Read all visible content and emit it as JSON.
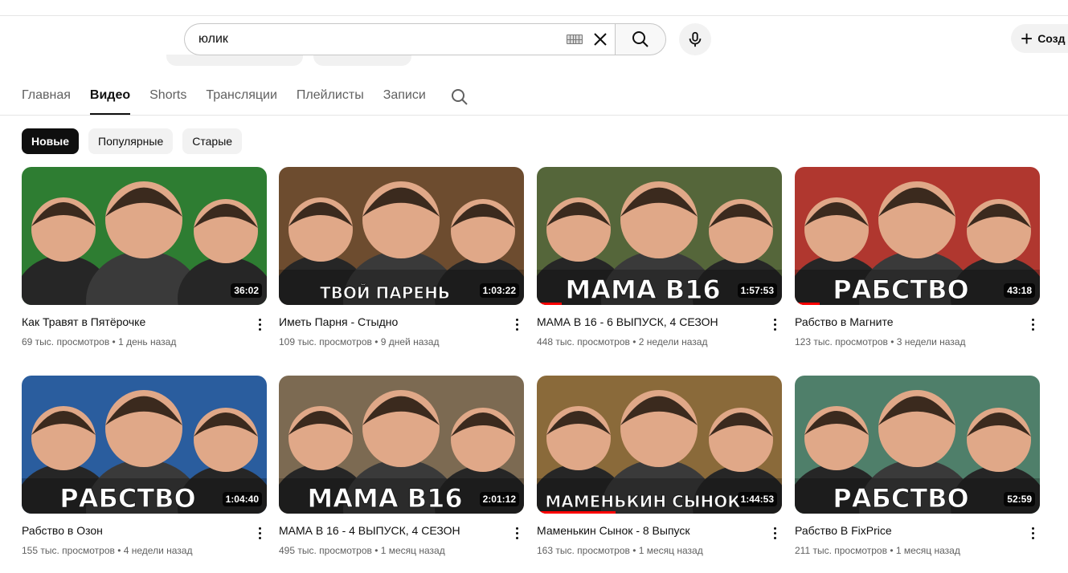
{
  "search": {
    "value": "юлик"
  },
  "header": {
    "create_label": "Созд"
  },
  "tabs": [
    {
      "label": "Главная",
      "active": false
    },
    {
      "label": "Видео",
      "active": true
    },
    {
      "label": "Shorts",
      "active": false
    },
    {
      "label": "Трансляции",
      "active": false
    },
    {
      "label": "Плейлисты",
      "active": false
    },
    {
      "label": "Записи",
      "active": false
    }
  ],
  "chips": [
    {
      "label": "Новые",
      "active": true
    },
    {
      "label": "Популярные",
      "active": false
    },
    {
      "label": "Старые",
      "active": false
    }
  ],
  "videos": [
    {
      "title": "Как Травят в Пятёрочке",
      "views": "69 тыс. просмотров",
      "age": "1 день назад",
      "duration": "36:02",
      "thumb_text": "",
      "bg": "#2e7d32",
      "progress": 0
    },
    {
      "title": "Иметь Парня - Стыдно",
      "views": "109 тыс. просмотров",
      "age": "9 дней назад",
      "duration": "1:03:22",
      "thumb_text": "ТВОЙ ПАРЕНЬ",
      "bg": "#6d4c2f",
      "progress": 0
    },
    {
      "title": "МАМА В 16 - 6 ВЫПУСК, 4 СЕЗОН",
      "views": "448 тыс. просмотров",
      "age": "2 недели назад",
      "duration": "1:57:53",
      "thumb_text": "МАМА В16",
      "bg": "#55663a",
      "progress": 0.1
    },
    {
      "title": "Рабство в Магните",
      "views": "123 тыс. просмотров",
      "age": "3 недели назад",
      "duration": "43:18",
      "thumb_text": "РАБСТВО",
      "bg": "#b0372f",
      "progress": 0.1
    },
    {
      "title": "Рабство в Озон",
      "views": "155 тыс. просмотров",
      "age": "4 недели назад",
      "duration": "1:04:40",
      "thumb_text": "РАБСТВО",
      "bg": "#2a5d9e",
      "progress": 0
    },
    {
      "title": "МАМА В 16 - 4 ВЫПУСК, 4 СЕЗОН",
      "views": "495 тыс. просмотров",
      "age": "1 месяц назад",
      "duration": "2:01:12",
      "thumb_text": "МАМА В16",
      "bg": "#7c6a52",
      "progress": 0
    },
    {
      "title": "Маменькин Сынок - 8 Выпуск",
      "views": "163 тыс. просмотров",
      "age": "1 месяц назад",
      "duration": "1:44:53",
      "thumb_text": "МАМЕНЬКИН СЫНОК",
      "bg": "#8a6a3a",
      "progress": 0.32
    },
    {
      "title": "Рабство В FixPrice",
      "views": "211 тыс. просмотров",
      "age": "1 месяц назад",
      "duration": "52:59",
      "thumb_text": "РАБСТВО",
      "bg": "#4f7f6a",
      "progress": 0
    }
  ],
  "icons": {
    "keyboard": "keyboard-icon",
    "clear": "close-icon",
    "search": "search-icon",
    "mic": "microphone-icon",
    "create": "plus-icon",
    "kebab": "more-vert-icon"
  }
}
